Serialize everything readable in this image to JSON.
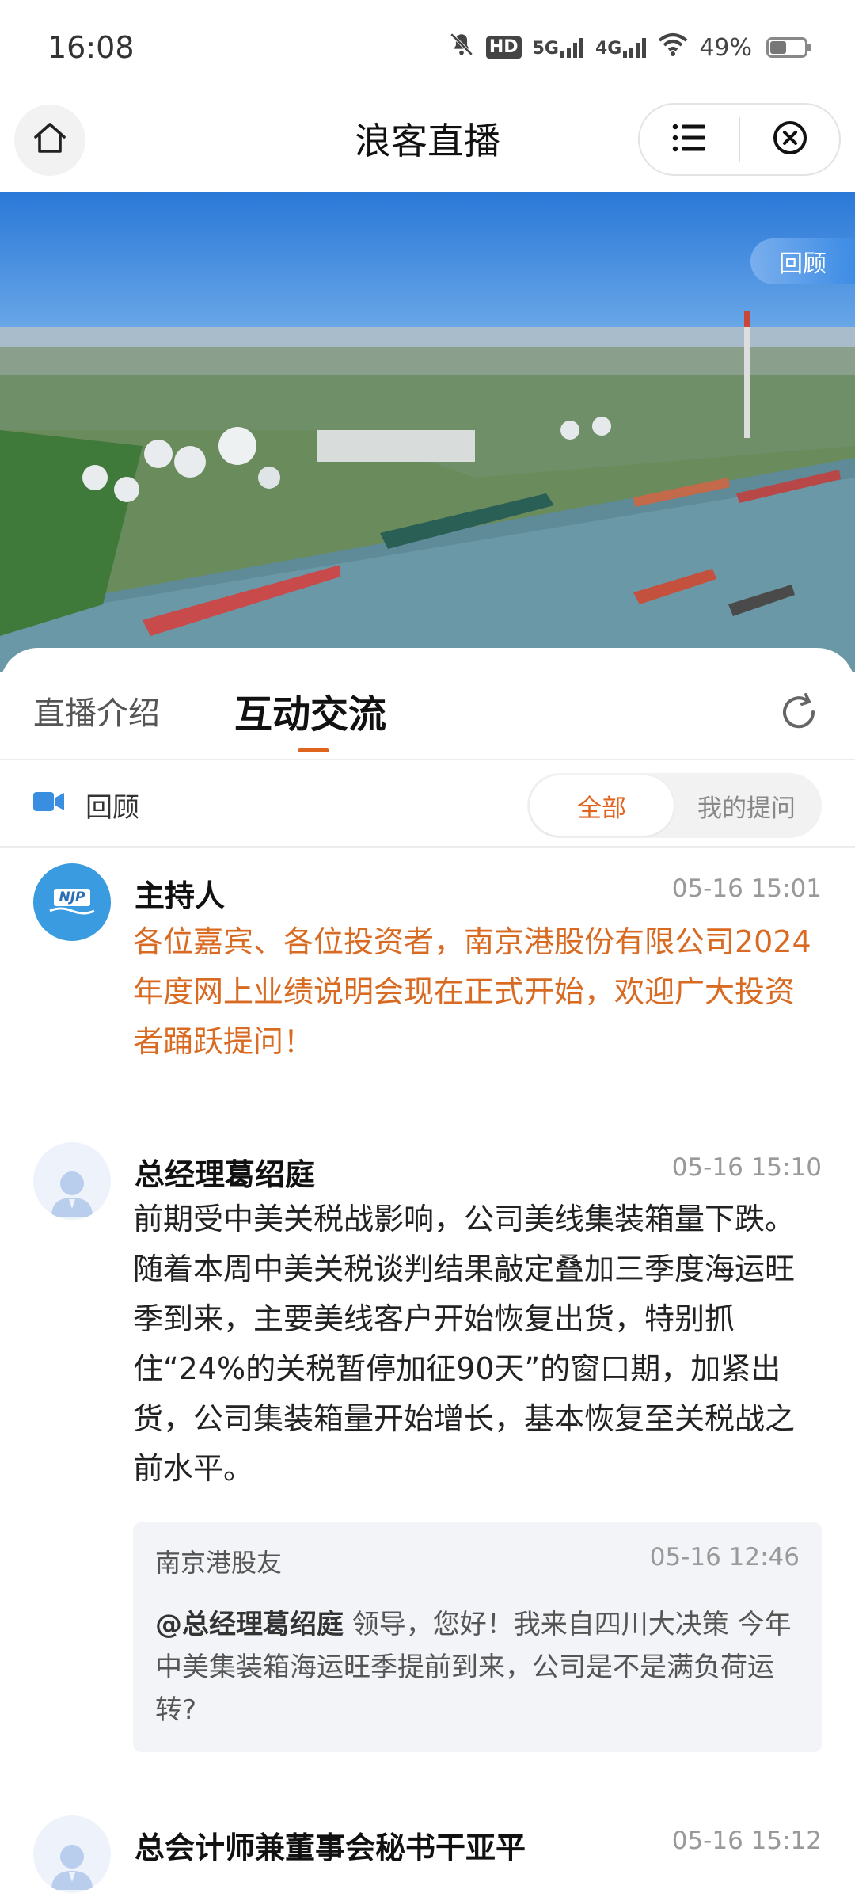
{
  "status_bar": {
    "time": "16:08",
    "net_1": "HD",
    "net_2": "5G",
    "net_3": "4G",
    "battery": "49%",
    "battery_level": 0.49,
    "icons": [
      "mute-bell-icon",
      "hd-icon",
      "5g-signal-icon",
      "4g-signal-icon",
      "wifi-icon",
      "battery-icon"
    ]
  },
  "header": {
    "title": "浪客直播",
    "home_icon": "home-icon",
    "menu_icon": "menu-icon",
    "close_icon": "close-icon"
  },
  "hero": {
    "badge": "回顾"
  },
  "tabs": {
    "intro": "直播介绍",
    "active": "互动交流",
    "refresh_icon": "refresh-icon",
    "accent_color": "#e0641e"
  },
  "filter": {
    "label": "回顾",
    "all": "全部",
    "mine": "我的提问"
  },
  "messages": [
    {
      "name": "主持人",
      "time": "05-16 15:01",
      "avatar_text": "NJP",
      "text": "各位嘉宾、各位投资者，南京港股份有限公司2024年度网上业绩说明会现在正式开始，欢迎广大投资者踊跃提问！"
    },
    {
      "name": "总经理葛绍庭",
      "time": "05-16 15:10",
      "text": "前期受中美关税战影响，公司美线集装箱量下跌。随着本周中美关税谈判结果敲定叠加三季度海运旺季到来，主要美线客户开始恢复出货，特别抓住“24%的关税暂停加征90天”的窗口期，加紧出货，公司集装箱量开始增长，基本恢复至关税战之前水平。",
      "quote": {
        "user": "南京港股友",
        "time": "05-16 12:46",
        "at": "@总经理葛绍庭",
        "body": " 领导，您好！我来自四川大决策 今年中美集装箱海运旺季提前到来，公司是不是满负荷运转?"
      }
    },
    {
      "name": "总会计师兼董事会秘书干亚平",
      "time": "05-16 15:12"
    }
  ]
}
